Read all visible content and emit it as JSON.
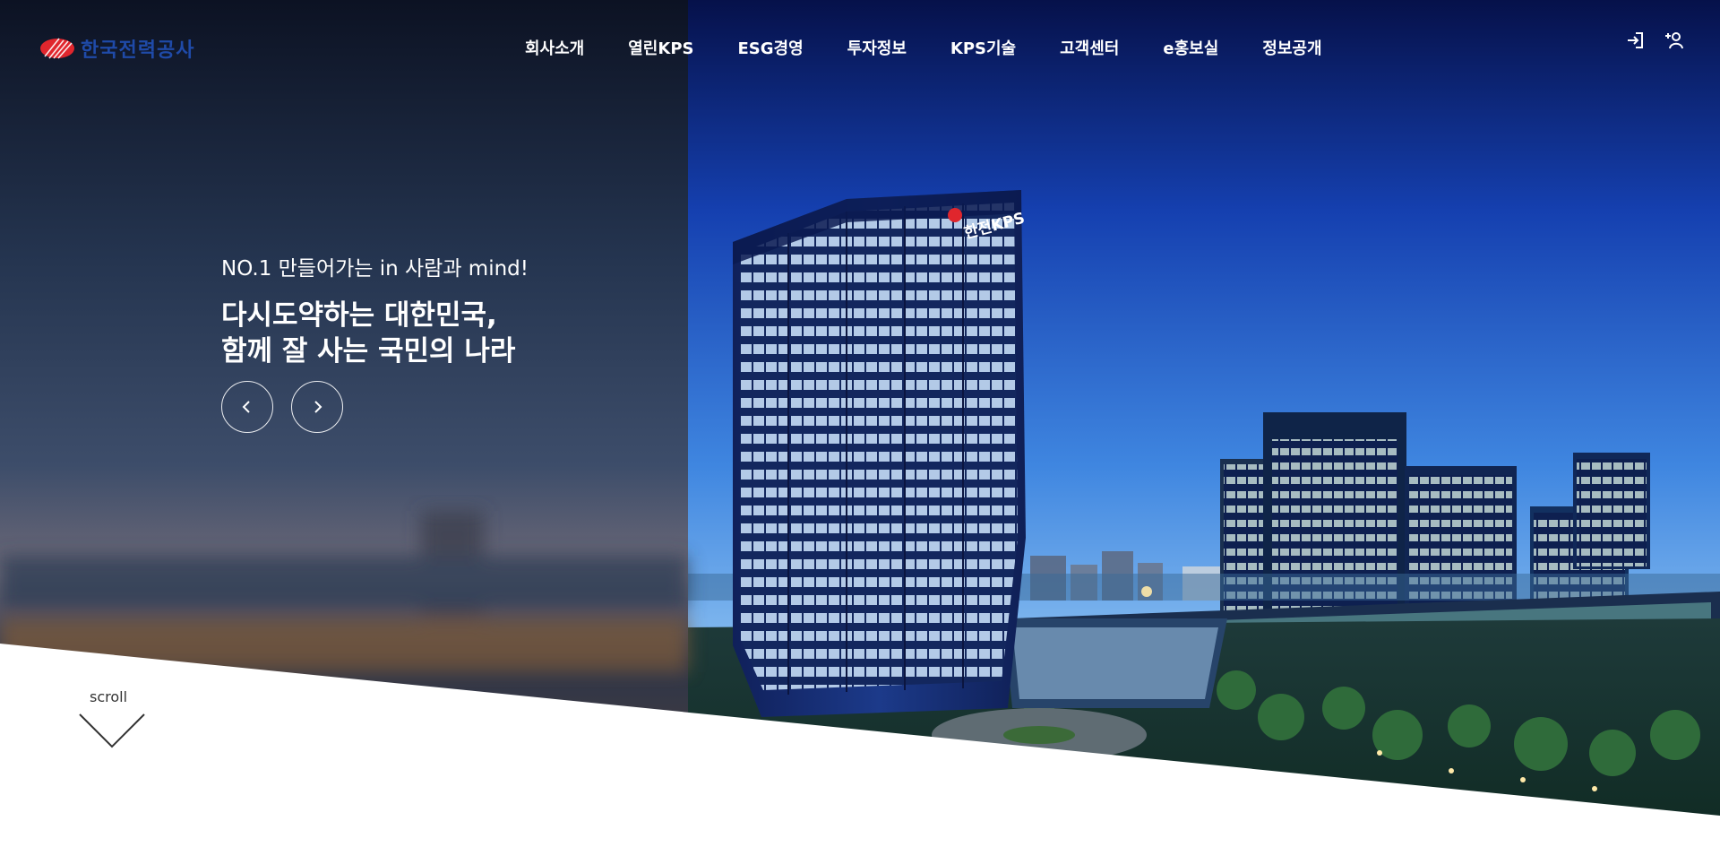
{
  "header": {
    "logo_text": "한국전력공사",
    "nav": [
      {
        "label": "회사소개"
      },
      {
        "label": "열린KPS"
      },
      {
        "label": "ESG경영"
      },
      {
        "label": "투자정보"
      },
      {
        "label": "KPS기술"
      },
      {
        "label": "고객센터"
      },
      {
        "label": "e홍보실"
      },
      {
        "label": "정보공개"
      }
    ],
    "utility_icons": [
      "login-icon",
      "join-member-icon"
    ]
  },
  "hero": {
    "subtitle": "NO.1 만들어가는 in 사람과 mind!",
    "title_line1": "다시도약하는 대한민국,",
    "title_line2": "함께 잘 사는 국민의 나라",
    "building_sign": "한전KPS",
    "controls": {
      "prev_icon": "chevron-left-icon",
      "next_icon": "chevron-right-icon"
    }
  },
  "scroll": {
    "label": "scroll",
    "icon": "chevron-down-icon"
  },
  "colors": {
    "logo_blue": "#1f4aa8",
    "logo_red": "#e0262d",
    "nav_text": "#ffffff",
    "sky_top": "#0a1a5c",
    "sky_mid": "#1e58c8",
    "sky_bottom": "#7fb8f0"
  }
}
